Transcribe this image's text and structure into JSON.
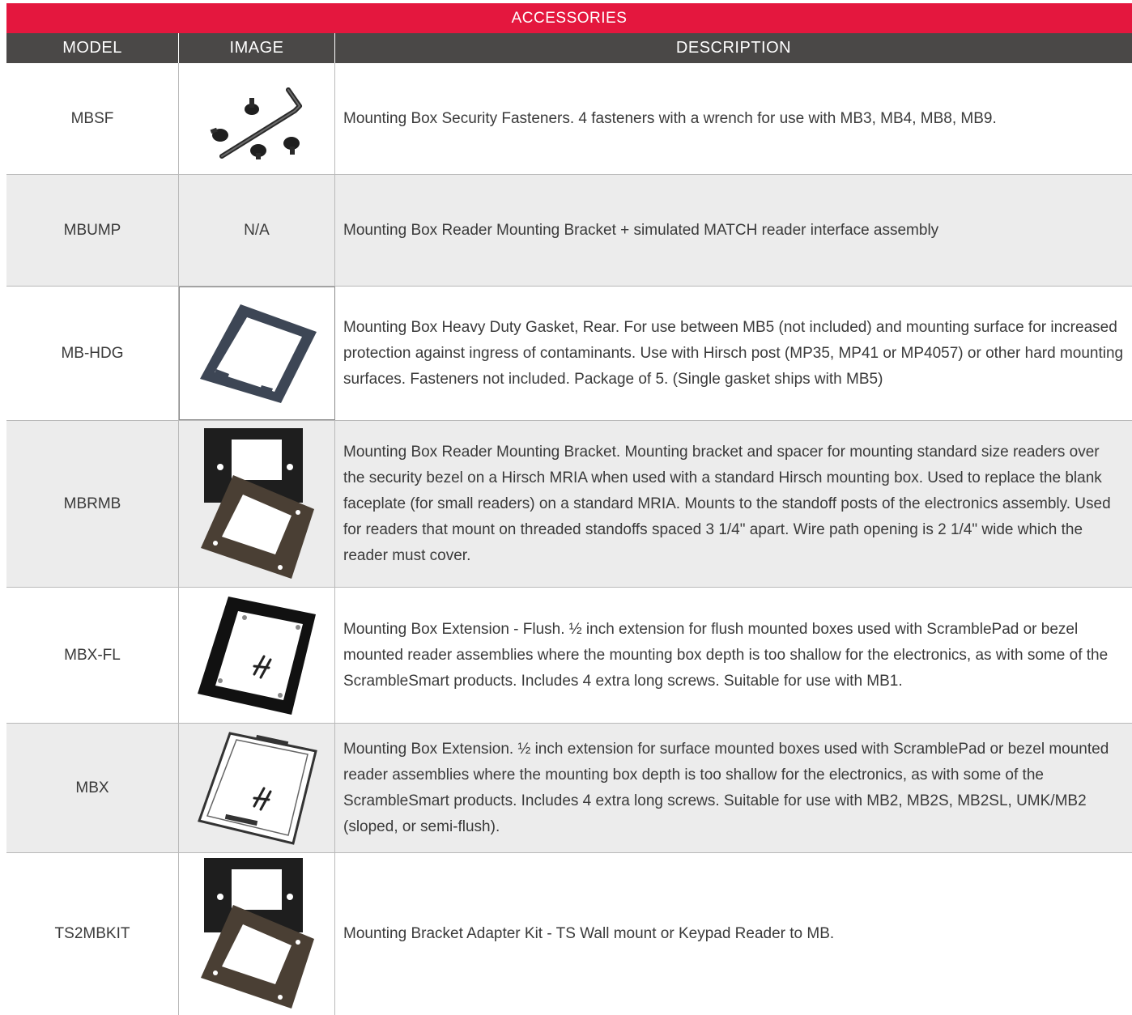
{
  "table": {
    "title": "ACCESSORIES",
    "headers": {
      "model": "MODEL",
      "image": "IMAGE",
      "description": "DESCRIPTION"
    },
    "rows": [
      {
        "model": "MBSF",
        "image": "fasteners-with-wrench-photo",
        "image_text": "",
        "description": "Mounting Box Security Fasteners.  4 fasteners with a wrench for use with MB3, MB4, MB8, MB9."
      },
      {
        "model": "MBUMP",
        "image": "",
        "image_text": "N/A",
        "description": "Mounting Box Reader Mounting Bracket + simulated MATCH reader interface assembly"
      },
      {
        "model": "MB-HDG",
        "image": "gasket-photo",
        "image_text": "",
        "description": "Mounting Box Heavy Duty Gasket, Rear. For use between MB5 (not included) and mounting surface for increased protection against ingress of contaminants. Use with Hirsch post (MP35, MP41 or MP4057) or other hard mounting surfaces. Fasteners not included. Package of 5. (Single gasket ships with MB5)"
      },
      {
        "model": "MBRMB",
        "image": "bracket-and-spacer-photo",
        "image_text": "",
        "description": "Mounting Box Reader Mounting Bracket. Mounting bracket and spacer for mounting standard size readers over the security bezel on a Hirsch MRIA when used with a standard Hirsch mounting box. Used to replace the blank faceplate (for small readers) on a standard MRIA. Mounts to the standoff posts of the electronics assembly. Used for readers that mount on threaded standoffs spaced 3 1/4\" apart. Wire path opening is 2 1/4\" wide which the reader must cover."
      },
      {
        "model": "MBX-FL",
        "image": "flush-extension-frame-photo",
        "image_text": "",
        "description": "Mounting Box Extension - Flush. ½ inch extension for flush mounted boxes used with ScramblePad or bezel mounted reader assemblies where the mounting box depth is too shallow for the electronics, as with some of the ScrambleSmart products. Includes 4 extra long screws. Suitable for use with MB1."
      },
      {
        "model": "MBX",
        "image": "surface-extension-frame-photo",
        "image_text": "",
        "description": "Mounting Box Extension. ½ inch extension for surface mounted boxes used with ScramblePad or bezel mounted reader assemblies where the mounting box depth is too shallow for the electronics, as with some of the ScrambleSmart products. Includes 4 extra long screws. Suitable for use with MB2, MB2S, MB2SL, UMK/MB2 (sloped, or semi-flush)."
      },
      {
        "model": "TS2MBKIT",
        "image": "bracket-adapter-kit-photo",
        "image_text": "",
        "description": "Mounting Bracket Adapter Kit - TS Wall mount or Keypad Reader to MB."
      }
    ]
  }
}
